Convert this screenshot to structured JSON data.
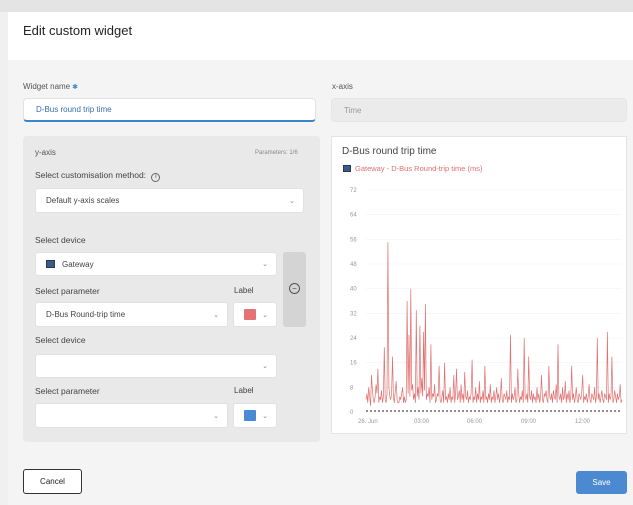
{
  "dialog": {
    "title": "Edit custom widget"
  },
  "widget_name": {
    "label": "Widget name",
    "value": "D-Bus round trip time"
  },
  "x_axis": {
    "label": "x-axis",
    "placeholder": "Time"
  },
  "y_axis": {
    "label": "y-axis",
    "parameters_count": "Parameters: 1/6",
    "customisation_label": "Select customisation method:",
    "customisation_value": "Default y-axis scales",
    "rows": [
      {
        "device_label": "Select device",
        "device_value": "Gateway",
        "parameter_label": "Select parameter",
        "parameter_value": "D-Bus Round-trip time",
        "label_label": "Label",
        "color": "#e57373"
      },
      {
        "device_label": "Select device",
        "device_value": "",
        "parameter_label": "Select parameter",
        "parameter_value": "",
        "label_label": "Label",
        "color": "#4a8ad4"
      }
    ]
  },
  "preview": {
    "title": "D-Bus round trip time",
    "legend": "Gateway - D-Bus Round-trip time (ms)"
  },
  "chart_data": {
    "type": "line",
    "title": "D-Bus round trip time",
    "series": [
      {
        "name": "Gateway - D-Bus Round-trip time (ms)",
        "color": "#e07070",
        "values": [
          4,
          6,
          3,
          8,
          5,
          2,
          12,
          7,
          4,
          3,
          5,
          9,
          6,
          14,
          3,
          5,
          4,
          7,
          3,
          5,
          21,
          4,
          3,
          6,
          55,
          8,
          5,
          4,
          6,
          18,
          5,
          3,
          7,
          10,
          4,
          3,
          3,
          5,
          4,
          6,
          8,
          3,
          5,
          3,
          4,
          36,
          6,
          25,
          5,
          40,
          7,
          9,
          4,
          6,
          3,
          33,
          5,
          8,
          4,
          28,
          6,
          11,
          5,
          26,
          7,
          35,
          4,
          6,
          5,
          8,
          3,
          22,
          4,
          6,
          5,
          9,
          3,
          4,
          6,
          5,
          15,
          4,
          3,
          5,
          7,
          3,
          16,
          4,
          5,
          3,
          6,
          4,
          8,
          3,
          5,
          4,
          12,
          3,
          6,
          14,
          4,
          5,
          7,
          3,
          9,
          4,
          6,
          3,
          13,
          5,
          4,
          7,
          3,
          5,
          4,
          6,
          17,
          3,
          5,
          4,
          8,
          3,
          6,
          4,
          10,
          3,
          5,
          4,
          7,
          3,
          15,
          4,
          5,
          3,
          6,
          4,
          9,
          3,
          5,
          4,
          7,
          3,
          5,
          8,
          4,
          6,
          3,
          5,
          11,
          4,
          3,
          6,
          5,
          4,
          7,
          3,
          5,
          4,
          25,
          3,
          6,
          4,
          5,
          8,
          3,
          4,
          14,
          6,
          3,
          5,
          4,
          7,
          3,
          24,
          5,
          4,
          6,
          3,
          18,
          5,
          4,
          7,
          3,
          6,
          4,
          5,
          3,
          8,
          4,
          6,
          3,
          5,
          12,
          4,
          3,
          6,
          5,
          7,
          4,
          3,
          15,
          5,
          4,
          6,
          3,
          7,
          5,
          4,
          9,
          3,
          22,
          5,
          4,
          6,
          3,
          8,
          4,
          5,
          10,
          3,
          6,
          4,
          7,
          3,
          5,
          15,
          4,
          6,
          3,
          5,
          8,
          4,
          3,
          6,
          5,
          4,
          7,
          12,
          3,
          5,
          4,
          6,
          3,
          5,
          9,
          4,
          3,
          6,
          5,
          4,
          8,
          3,
          5,
          24,
          4,
          6,
          3,
          5,
          7,
          4,
          3,
          6,
          5,
          4,
          26,
          3,
          6,
          4,
          5,
          18,
          3,
          4,
          7,
          5,
          3,
          6,
          4,
          5,
          9,
          3,
          4
        ]
      }
    ],
    "threshold": 0,
    "yticks": [
      "72",
      "64",
      "56",
      "48",
      "40",
      "32",
      "24",
      "16",
      "8",
      "0"
    ],
    "ylim": [
      0,
      72
    ],
    "xticks": [
      "26. Jun",
      "03:00",
      "06:00",
      "09:00",
      "12:00"
    ],
    "grid": true
  }
}
